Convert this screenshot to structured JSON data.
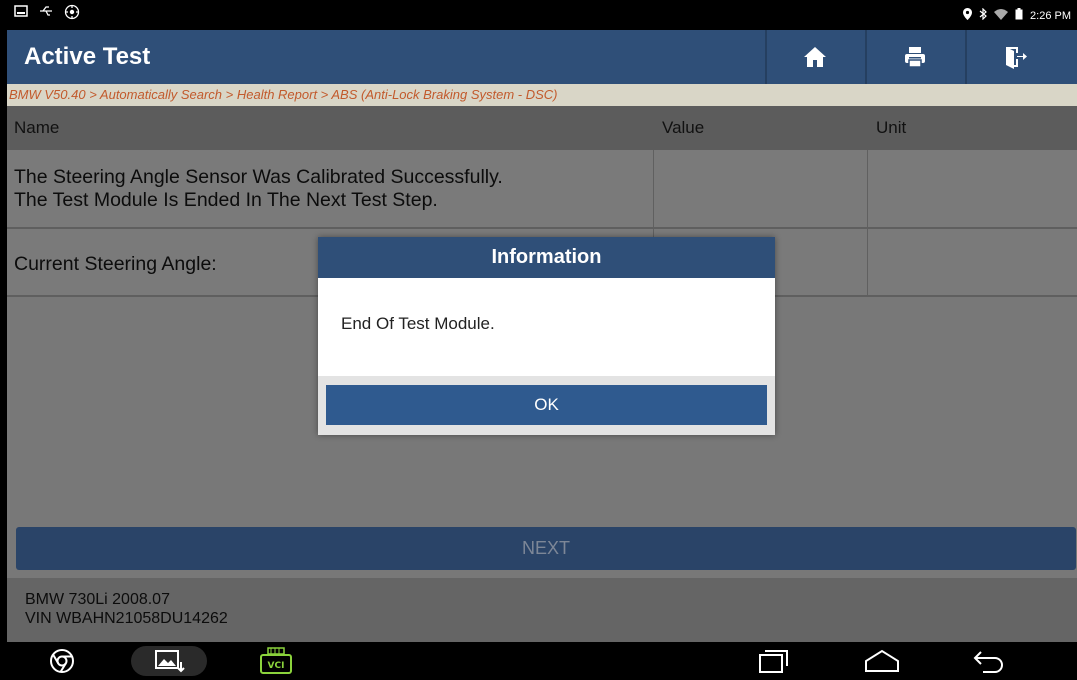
{
  "status_bar": {
    "left_icons": [
      "screenshot-icon",
      "usb-icon",
      "settings-icon"
    ],
    "right_icons": [
      "location-icon",
      "bluetooth-icon",
      "wifi-icon",
      "battery-icon"
    ],
    "time": "2:26 PM"
  },
  "header": {
    "title": "Active Test",
    "buttons": [
      "home-icon",
      "print-icon",
      "exit-icon"
    ]
  },
  "breadcrumb": "BMW V50.40 > Automatically Search > Health Report > ABS (Anti-Lock Braking System - DSC)",
  "table": {
    "columns": [
      "Name",
      "Value",
      "Unit"
    ],
    "rows": [
      {
        "name": "The Steering Angle Sensor Was Calibrated Successfully.",
        "name2": "The Test Module Is Ended In The Next Test Step.",
        "value": "",
        "unit": ""
      },
      {
        "name": "Current Steering Angle:",
        "value": "",
        "unit": ""
      }
    ]
  },
  "next_button": "NEXT",
  "footer": {
    "vehicle": "BMW 730Li 2008.07",
    "vin": "VIN WBAHN21058DU14262"
  },
  "dialog": {
    "title": "Information",
    "message": "End Of Test Module.",
    "ok_label": "OK"
  },
  "nav": {
    "vci_label": "VCI",
    "items": [
      "chrome-icon",
      "gallery-icon",
      "vci-icon",
      "recent-apps-icon",
      "home-nav-icon",
      "back-icon"
    ]
  },
  "colors": {
    "header_blue": "#2f4f78",
    "breadcrumb_text": "#c25a2c",
    "ok_button": "#2f5a8f"
  }
}
